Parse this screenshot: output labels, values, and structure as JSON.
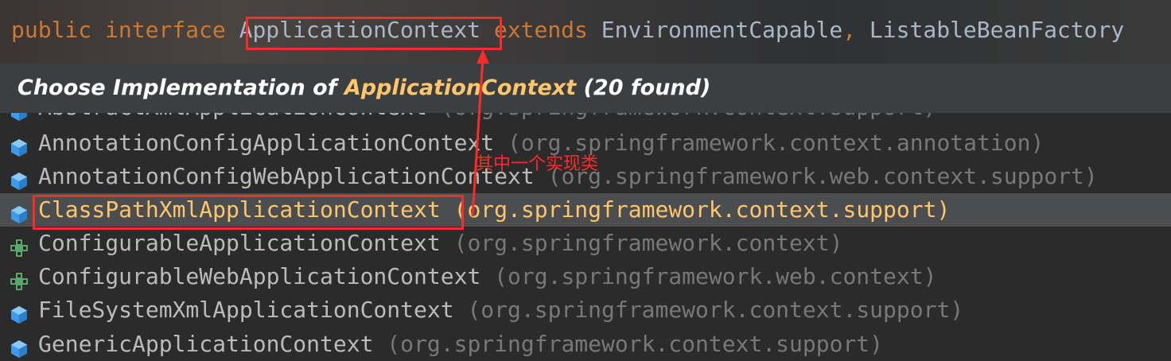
{
  "code_line": {
    "kw_public": "public",
    "kw_interface": "interface",
    "type_name": "ApplicationContext",
    "kw_extends": "extends",
    "parent1": "EnvironmentCapable",
    "comma": ",",
    "parent2": "ListableBeanFactory"
  },
  "popup": {
    "title_prefix": "Choose Implementation of ",
    "title_type": "ApplicationContext",
    "title_suffix": " (20 found)"
  },
  "results": [
    {
      "name": "AbstractXmlApplicationContext",
      "package": "(org.springframework.context.support)",
      "icon": "class-icon",
      "selected": false
    },
    {
      "name": "AnnotationConfigApplicationContext",
      "package": "(org.springframework.context.annotation)",
      "icon": "class-icon",
      "selected": false
    },
    {
      "name": "AnnotationConfigWebApplicationContext",
      "package": "(org.springframework.web.context.support)",
      "icon": "class-icon",
      "selected": false
    },
    {
      "name": "ClassPathXmlApplicationContext",
      "package": "(org.springframework.context.support)",
      "icon": "class-icon",
      "selected": true
    },
    {
      "name": "ConfigurableApplicationContext",
      "package": "(org.springframework.context)",
      "icon": "interface-icon",
      "selected": false
    },
    {
      "name": "ConfigurableWebApplicationContext",
      "package": "(org.springframework.web.context)",
      "icon": "interface-icon",
      "selected": false
    },
    {
      "name": "FileSystemXmlApplicationContext",
      "package": "(org.springframework.context.support)",
      "icon": "class-icon",
      "selected": false
    },
    {
      "name": "GenericApplicationContext",
      "package": "(org.springframework.context.support)",
      "icon": "class-icon",
      "selected": false
    }
  ],
  "annotation": {
    "text": "其中一个实现类",
    "color": "#ff2b2b"
  },
  "colors": {
    "keyword": "#cc7832",
    "identifier": "#a9b7c6",
    "highlight": "#ffc66d",
    "package": "#787878",
    "class_icon": "#3d9be9",
    "interface_icon": "#59a869"
  }
}
